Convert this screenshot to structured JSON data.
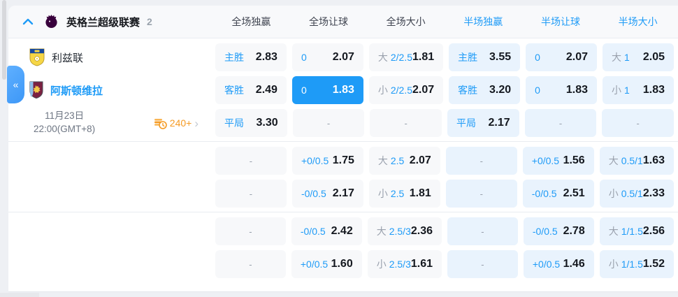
{
  "page": {
    "background": "#eef0f4"
  },
  "colors": {
    "accent_blue": "#1e9bf7",
    "selected_cell_bg": "#1e9bf7",
    "full_cell_bg": "#f7f8fa",
    "half_cell_bg": "#e9f3fd",
    "orange": "#f59a23"
  },
  "league_header": {
    "league_name": "英格兰超级联赛",
    "match_count": "2",
    "columns": [
      {
        "label": "全场独赢",
        "scope": "full"
      },
      {
        "label": "全场让球",
        "scope": "full"
      },
      {
        "label": "全场大小",
        "scope": "full"
      },
      {
        "label": "半场独赢",
        "scope": "half"
      },
      {
        "label": "半场让球",
        "scope": "half"
      },
      {
        "label": "半场大小",
        "scope": "half"
      }
    ]
  },
  "match": {
    "home_team": "利兹联",
    "away_team": "阿斯顿维拉",
    "date": "11月23日",
    "time": "22:00(GMT+8)",
    "more_markets": "240+",
    "more_markets_chevron": "›"
  },
  "collapse_tab": {
    "glyph": "«"
  },
  "odds": {
    "dash": "-",
    "rows": [
      {
        "left": "home",
        "cells": [
          {
            "label": "主胜",
            "value": "2.83",
            "tone": "full"
          },
          {
            "label": "0",
            "value": "2.07",
            "tone": "full"
          },
          {
            "pre": "大",
            "label": "2/2.5",
            "value": "1.81",
            "tone": "full"
          },
          {
            "label": "主胜",
            "value": "3.55",
            "tone": "half"
          },
          {
            "label": "0",
            "value": "2.07",
            "tone": "half"
          },
          {
            "pre": "大",
            "label": "1",
            "value": "2.05",
            "tone": "half"
          }
        ]
      },
      {
        "left": "away",
        "cells": [
          {
            "label": "客胜",
            "value": "2.49",
            "tone": "full"
          },
          {
            "label": "0",
            "value": "1.83",
            "tone": "full",
            "selected": true
          },
          {
            "pre": "小",
            "label": "2/2.5",
            "value": "2.07",
            "tone": "full"
          },
          {
            "label": "客胜",
            "value": "3.20",
            "tone": "half"
          },
          {
            "label": "0",
            "value": "1.83",
            "tone": "half"
          },
          {
            "pre": "小",
            "label": "1",
            "value": "1.83",
            "tone": "half"
          }
        ]
      },
      {
        "left": "meta",
        "cells": [
          {
            "label": "平局",
            "value": "3.30",
            "tone": "full"
          },
          {
            "dash": true,
            "tone": "full"
          },
          {
            "dash": true,
            "tone": "full"
          },
          {
            "label": "平局",
            "value": "2.17",
            "tone": "half"
          },
          {
            "dash": true,
            "tone": "half"
          },
          {
            "dash": true,
            "tone": "half"
          }
        ]
      },
      {
        "separator_before": true,
        "cells": [
          {
            "dash": true,
            "tone": "full"
          },
          {
            "label": "+0/0.5",
            "value": "1.75",
            "tone": "full"
          },
          {
            "pre": "大",
            "label": "2.5",
            "value": "2.07",
            "tone": "full"
          },
          {
            "dash": true,
            "tone": "half"
          },
          {
            "label": "+0/0.5",
            "value": "1.56",
            "tone": "half"
          },
          {
            "pre": "大",
            "label": "0.5/1",
            "value": "1.63",
            "tone": "half"
          }
        ]
      },
      {
        "cells": [
          {
            "dash": true,
            "tone": "full"
          },
          {
            "label": "-0/0.5",
            "value": "2.17",
            "tone": "full"
          },
          {
            "pre": "小",
            "label": "2.5",
            "value": "1.81",
            "tone": "full"
          },
          {
            "dash": true,
            "tone": "half"
          },
          {
            "label": "-0/0.5",
            "value": "2.51",
            "tone": "half"
          },
          {
            "pre": "小",
            "label": "0.5/1",
            "value": "2.33",
            "tone": "half"
          }
        ]
      },
      {
        "separator_before": true,
        "cells": [
          {
            "dash": true,
            "tone": "full"
          },
          {
            "label": "-0/0.5",
            "value": "2.42",
            "tone": "full"
          },
          {
            "pre": "大",
            "label": "2.5/3",
            "value": "2.36",
            "tone": "full"
          },
          {
            "dash": true,
            "tone": "half"
          },
          {
            "label": "-0/0.5",
            "value": "2.78",
            "tone": "half"
          },
          {
            "pre": "大",
            "label": "1/1.5",
            "value": "2.56",
            "tone": "half"
          }
        ]
      },
      {
        "cells": [
          {
            "dash": true,
            "tone": "full"
          },
          {
            "label": "+0/0.5",
            "value": "1.60",
            "tone": "full"
          },
          {
            "pre": "小",
            "label": "2.5/3",
            "value": "1.61",
            "tone": "full"
          },
          {
            "dash": true,
            "tone": "half"
          },
          {
            "label": "+0/0.5",
            "value": "1.46",
            "tone": "half"
          },
          {
            "pre": "小",
            "label": "1/1.5",
            "value": "1.52",
            "tone": "half"
          }
        ]
      }
    ]
  }
}
